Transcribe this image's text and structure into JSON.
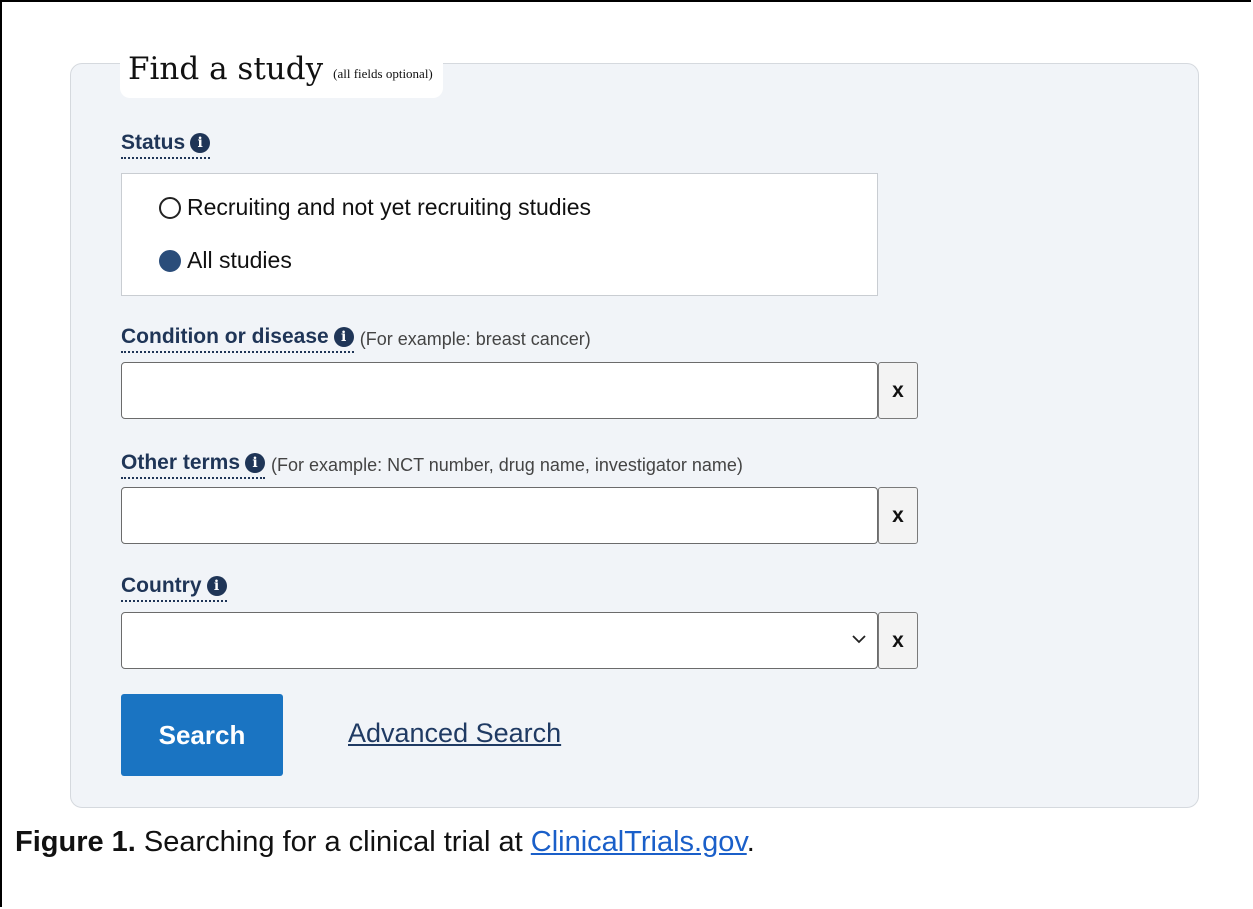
{
  "form": {
    "title": "Find a study",
    "note": "(all fields optional)",
    "status": {
      "label": "Status",
      "options": [
        {
          "label": "Recruiting and not yet recruiting studies",
          "selected": false
        },
        {
          "label": "All studies",
          "selected": true
        }
      ]
    },
    "condition": {
      "label": "Condition or disease",
      "hint": "(For example: breast cancer)",
      "value": "",
      "clear_label": "x"
    },
    "other_terms": {
      "label": "Other terms",
      "hint": "(For example: NCT number, drug name, investigator name)",
      "value": "",
      "clear_label": "x"
    },
    "country": {
      "label": "Country",
      "value": "",
      "clear_label": "x"
    },
    "search_label": "Search",
    "advanced_label": "Advanced Search"
  },
  "caption": {
    "prefix": "Figure 1.",
    "text": "Searching for a clinical trial at",
    "link": "ClinicalTrials.gov",
    "suffix": "."
  },
  "colors": {
    "panel_bg": "#f1f4f8",
    "label": "#1f3557",
    "search_button": "#1a74c2",
    "radio_checked": "#2a4d7a",
    "caption_link": "#1a5fc9"
  },
  "icons": [
    "info-icon",
    "chevron-down-icon"
  ]
}
